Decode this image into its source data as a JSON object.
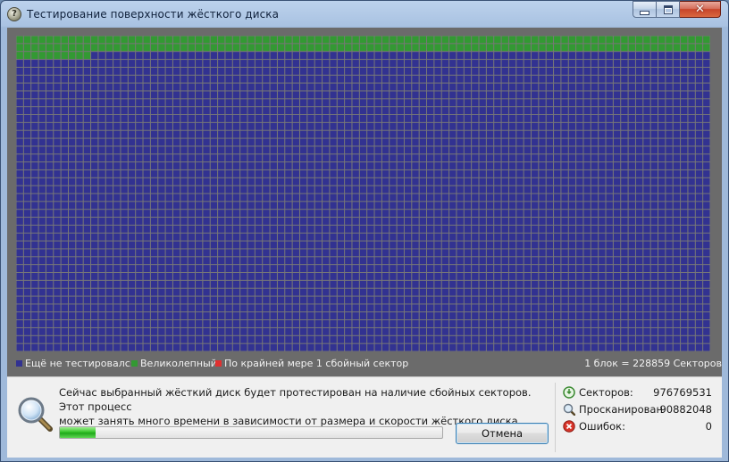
{
  "window": {
    "title": "Тестирование поверхности жёсткого диска",
    "app_icon_glyph": "?",
    "buttons": [
      "minimize",
      "maximize",
      "close"
    ]
  },
  "sector_map": {
    "columns": 93,
    "rows": 40,
    "good_blocks": 196,
    "bad_blocks": 0,
    "colors": {
      "untested": "#323291",
      "good": "#339933",
      "bad": "#e03030",
      "grid": "#777777"
    }
  },
  "legend": {
    "untested": "Ещё не тестировался",
    "good": "Великолепный",
    "bad": "По крайней мере 1 сбойный сектор",
    "scale": "1 блок = 228859 Секторов"
  },
  "panel": {
    "description_line1": "Сейчас выбранный жёсткий диск будет протестирован на наличие сбойных секторов. Этот процесс",
    "description_line2": "может занять много времени в зависимости от размера и скорости жёсткого диска.",
    "progress": 0.093,
    "cancel_label": "Отмена",
    "stats": [
      {
        "icon": "sectors-icon",
        "label": "Секторов:",
        "value": "976769531"
      },
      {
        "icon": "scanned-magnifier-icon",
        "label": "Просканирован",
        "value": "90882048"
      },
      {
        "icon": "error-icon",
        "label": "Ошибок:",
        "value": "0"
      }
    ]
  }
}
